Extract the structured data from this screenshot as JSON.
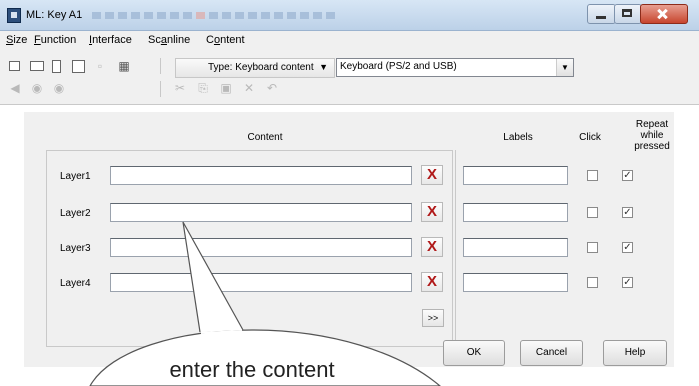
{
  "window": {
    "title": "ML: Key A1"
  },
  "menu": {
    "items": [
      {
        "pre": "",
        "u": "S",
        "post": "ize"
      },
      {
        "pre": "",
        "u": "F",
        "post": "unction"
      },
      {
        "pre": "",
        "u": "I",
        "post": "nterface"
      },
      {
        "pre": "Sc",
        "u": "a",
        "post": "nline"
      },
      {
        "pre": "C",
        "u": "o",
        "post": "ntent"
      }
    ]
  },
  "toolbar": {
    "type_label": "Type: Keyboard content",
    "type_arrow": "▼",
    "keyboard_value": "Keyboard (PS/2 and USB)",
    "keyboard_arrow": "▼"
  },
  "headers": {
    "content": "Content",
    "labels": "Labels",
    "click": "Click",
    "repeat": "Repeat while pressed"
  },
  "layers": [
    {
      "label": "Layer1",
      "click": false,
      "repeat": true
    },
    {
      "label": "Layer2",
      "click": false,
      "repeat": true
    },
    {
      "label": "Layer3",
      "click": false,
      "repeat": true
    },
    {
      "label": "Layer4",
      "click": false,
      "repeat": true
    }
  ],
  "icons": {
    "clear": "X",
    "checked": "✓",
    "more": ">>"
  },
  "buttons": {
    "ok": "OK",
    "cancel": "Cancel",
    "help": "Help"
  },
  "callout": {
    "text": "enter the content"
  }
}
